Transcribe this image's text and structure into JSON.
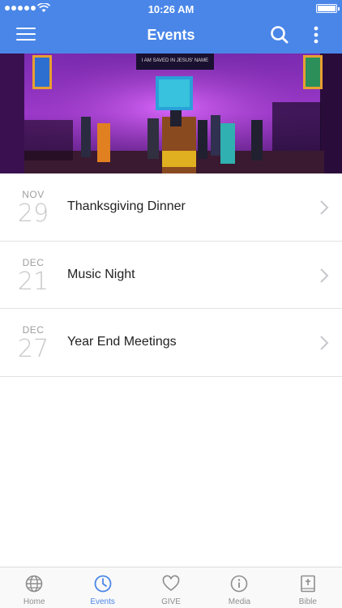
{
  "status_bar": {
    "time": "10:26 AM"
  },
  "header": {
    "title": "Events",
    "menu_icon": "hamburger-menu-icon",
    "search_icon": "search-icon",
    "more_icon": "more-vertical-icon"
  },
  "hero": {
    "description_icon": "church-stage-photo",
    "screen_text": "I AM SAVED IN JESUS' NAME"
  },
  "events": [
    {
      "month": "NOV",
      "day": "29",
      "title": "Thanksgiving Dinner"
    },
    {
      "month": "DEC",
      "day": "21",
      "title": "Music Night"
    },
    {
      "month": "DEC",
      "day": "27",
      "title": "Year End Meetings"
    }
  ],
  "tabs": [
    {
      "label": "Home",
      "icon": "globe-icon",
      "active": false
    },
    {
      "label": "Events",
      "icon": "clock-icon",
      "active": true
    },
    {
      "label": "GIVE",
      "icon": "heart-icon",
      "active": false
    },
    {
      "label": "Media",
      "icon": "info-icon",
      "active": false
    },
    {
      "label": "Bible",
      "icon": "bible-icon",
      "active": false
    }
  ],
  "colors": {
    "accent": "#4a86e8",
    "inactive": "#8e8e8e",
    "divider": "#e3e3e3"
  }
}
